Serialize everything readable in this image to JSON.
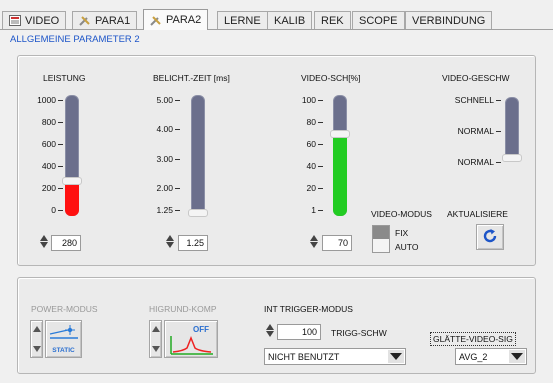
{
  "tabs": [
    {
      "label": "VIDEO",
      "icon": "video-icon"
    },
    {
      "label": "PARA1",
      "icon": "tools-icon"
    },
    {
      "label": "PARA2",
      "icon": "tools-icon"
    },
    {
      "label": "LERNE"
    },
    {
      "label": "KALIB"
    },
    {
      "label": "REK"
    },
    {
      "label": "SCOPE"
    },
    {
      "label": "VERBINDUNG"
    }
  ],
  "active_tab": "PARA2",
  "section_title": "ALLGEMEINE PARAMETER 2",
  "sliders": {
    "leistung": {
      "label": "LEISTUNG",
      "ticks": [
        "1000",
        "800",
        "600",
        "400",
        "200",
        "0"
      ],
      "value": "280",
      "level": 0.28,
      "fill_color": "#ff1010"
    },
    "belicht": {
      "label": "BELICHT.-ZEIT [ms]",
      "ticks": [
        "5.00",
        "4.00",
        "3.00",
        "2.00",
        "1.25"
      ],
      "value": "1.25",
      "level": 0.0
    },
    "video_sch": {
      "label": "VIDEO-SCH[%]",
      "ticks": [
        "100",
        "80",
        "60",
        "40",
        "20",
        "1"
      ],
      "value": "70",
      "level": 0.7,
      "fill_color": "#22cc22"
    },
    "video_geschw": {
      "label": "VIDEO-GESCHW",
      "ticks": [
        "SCHNELL",
        "NORMAL",
        "NORMAL"
      ],
      "level": 0.0
    }
  },
  "video_modus": {
    "label": "VIDEO-MODUS",
    "options": [
      "FIX",
      "AUTO"
    ],
    "selected": "FIX"
  },
  "aktualisiere": {
    "label": "AKTUALISIERE"
  },
  "bottom": {
    "power_modus": {
      "label": "POWER-MODUS",
      "button_text": "STATIC"
    },
    "higrund_komp": {
      "label": "HIGRUND-KOMP",
      "button_text": "OFF"
    },
    "int_trigger": {
      "label": "INT TRIGGER-MODUS",
      "trigg_value": "100",
      "trigg_label": "TRIGG-SCHW",
      "mode": "NICHT BENUTZT"
    },
    "glaette": {
      "label": "GLÄTTE-VIDEO-SIG",
      "value": "AVG_2"
    }
  },
  "colors": {
    "accent_blue": "#1d55c8",
    "track": "#6b6f8c"
  }
}
